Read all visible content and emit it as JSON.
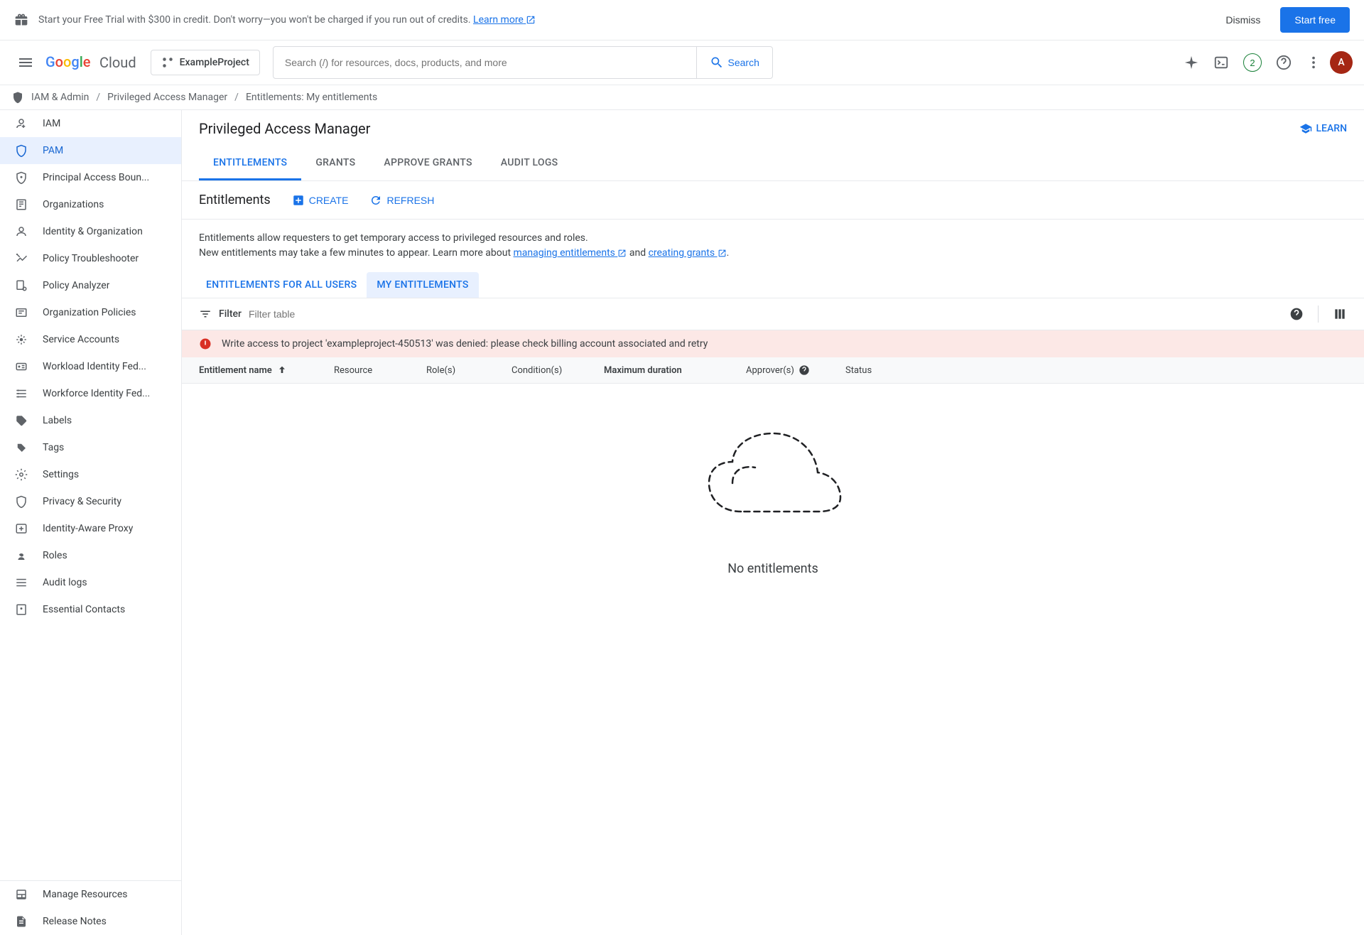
{
  "banner": {
    "text_prefix": "Start your Free Trial with $300 in credit. Don't worry—you won't be charged if you run out of credits. ",
    "learn_more": "Learn more",
    "dismiss": "Dismiss",
    "cta": "Start free"
  },
  "header": {
    "logo_cloud": "Cloud",
    "project": "ExampleProject",
    "search_placeholder": "Search (/) for resources, docs, products, and more",
    "search_button": "Search",
    "notif_count": "2",
    "avatar_letter": "A"
  },
  "breadcrumb": {
    "item1": "IAM & Admin",
    "item2": "Privileged Access Manager",
    "item3": "Entitlements:  My entitlements"
  },
  "sidebar": {
    "items": [
      {
        "label": "IAM"
      },
      {
        "label": "PAM"
      },
      {
        "label": "Principal Access Boun..."
      },
      {
        "label": "Organizations"
      },
      {
        "label": "Identity & Organization"
      },
      {
        "label": "Policy Troubleshooter"
      },
      {
        "label": "Policy Analyzer"
      },
      {
        "label": "Organization Policies"
      },
      {
        "label": "Service Accounts"
      },
      {
        "label": "Workload Identity Fed..."
      },
      {
        "label": "Workforce Identity Fed..."
      },
      {
        "label": "Labels"
      },
      {
        "label": "Tags"
      },
      {
        "label": "Settings"
      },
      {
        "label": "Privacy & Security"
      },
      {
        "label": "Identity-Aware Proxy"
      },
      {
        "label": "Roles"
      },
      {
        "label": "Audit logs"
      },
      {
        "label": "Essential Contacts"
      }
    ],
    "footer1": "Manage Resources",
    "footer2": "Release Notes"
  },
  "page": {
    "title": "Privileged Access Manager",
    "learn": "LEARN"
  },
  "tabs": [
    {
      "label": "ENTITLEMENTS"
    },
    {
      "label": "GRANTS"
    },
    {
      "label": "APPROVE GRANTS"
    },
    {
      "label": "AUDIT LOGS"
    }
  ],
  "section": {
    "title": "Entitlements",
    "create": "CREATE",
    "refresh": "REFRESH"
  },
  "description": {
    "line1": "Entitlements allow requesters to get temporary access to privileged resources and roles.",
    "line2a": "New entitlements may take a few minutes to appear. Learn more about ",
    "link1": "managing entitlements",
    "and": " and ",
    "link2": "creating grants",
    "period": "."
  },
  "subtabs": [
    {
      "label": "ENTITLEMENTS FOR ALL USERS"
    },
    {
      "label": "MY ENTITLEMENTS"
    }
  ],
  "filter": {
    "label": "Filter",
    "placeholder": "Filter table"
  },
  "error": {
    "message": "Write access to project 'exampleproject-450513' was denied: please check billing account associated and retry"
  },
  "columns": {
    "name": "Entitlement name",
    "resource": "Resource",
    "roles": "Role(s)",
    "conditions": "Condition(s)",
    "duration": "Maximum duration",
    "approvers": "Approver(s)",
    "status": "Status"
  },
  "empty": {
    "text": "No entitlements"
  }
}
